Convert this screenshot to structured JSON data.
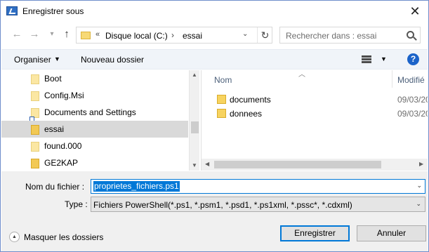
{
  "window": {
    "title": "Enregistrer sous",
    "close_glyph": "✕"
  },
  "nav": {
    "back_glyph": "←",
    "forward_glyph": "→",
    "recent_glyph": "▾",
    "up_glyph": "↑",
    "address": {
      "chevron": "«",
      "crumbs": [
        "Disque local (C:)",
        "essai"
      ],
      "separator": "›",
      "dropdown_glyph": "⌄",
      "refresh_glyph": "↻"
    },
    "search": {
      "placeholder": "Rechercher dans : essai"
    }
  },
  "toolbar": {
    "organise_label": "Organiser",
    "organise_glyph": "▼",
    "new_folder_label": "Nouveau dossier",
    "view_dropdown_glyph": "▼",
    "help_glyph": "?"
  },
  "tree": {
    "items": [
      {
        "label": "Boot",
        "selected": false
      },
      {
        "label": "Config.Msi",
        "selected": false
      },
      {
        "label": "Documents and Settings",
        "selected": false
      },
      {
        "label": "essai",
        "selected": true
      },
      {
        "label": "found.000",
        "selected": false
      },
      {
        "label": "GE2KAP",
        "selected": false
      }
    ],
    "scroll_up": "▲",
    "scroll_down": "▼"
  },
  "files": {
    "sort_glyph": "︿",
    "col_name": "Nom",
    "col_modified": "Modifié",
    "rows": [
      {
        "name": "documents",
        "date": "09/03/20"
      },
      {
        "name": "donnees",
        "date": "09/03/20"
      }
    ],
    "scroll_left": "◀",
    "scroll_right": "▶"
  },
  "form": {
    "filename_label": "Nom du fichier :",
    "filename_value": "proprietes_fichiers.ps1",
    "filename_dd": "⌄",
    "type_label": "Type :",
    "type_value": "Fichiers PowerShell(*.ps1, *.psm1, *.psd1, *.ps1xml, *.pssc*, *.cdxml)",
    "type_dd": "⌄"
  },
  "footer": {
    "hide_folders_glyph": "▲",
    "hide_folders_label": "Masquer les dossiers",
    "save_label": "Enregistrer",
    "cancel_label": "Annuler"
  },
  "colors": {
    "accent": "#0078d7",
    "selection": "#d9d9d9",
    "folder": "#f7d35f",
    "toolbar_bg": "#f0f4f9"
  }
}
